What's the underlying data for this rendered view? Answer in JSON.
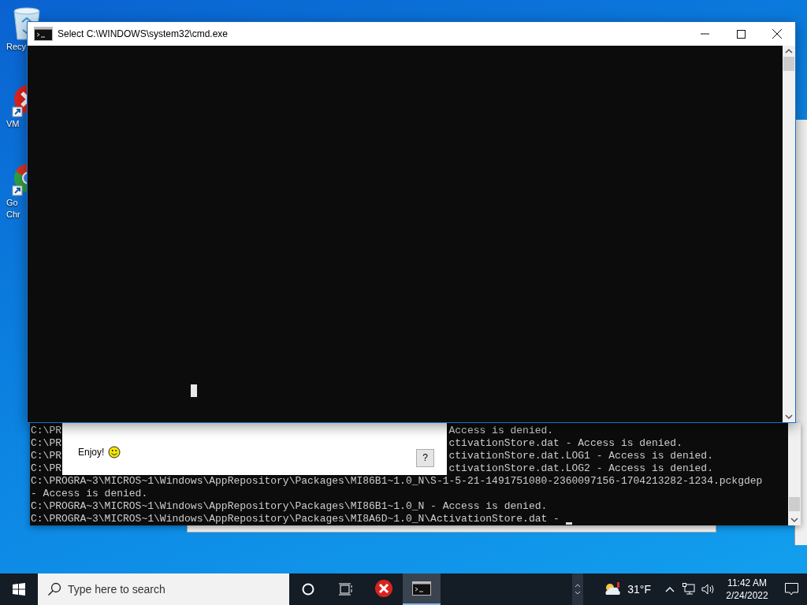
{
  "desktop_icons": [
    {
      "kind": "bin",
      "label_lines": [
        "Recy"
      ]
    },
    {
      "kind": "error",
      "label_lines": [
        "VM"
      ]
    },
    {
      "kind": "round",
      "label_lines": [
        "Go",
        "Chr"
      ]
    }
  ],
  "background_console": {
    "lines": [
      {
        "kind": "split",
        "left": "C:\\PR",
        "right": "Access is denied."
      },
      {
        "kind": "split",
        "left": "C:\\PR",
        "right": "ctivationStore.dat - Access is denied."
      },
      {
        "kind": "split",
        "left": "C:\\PR",
        "right": "ctivationStore.dat.LOG1 - Access is denied."
      },
      {
        "kind": "split",
        "left": "C:\\PR",
        "right": "ctivationStore.dat.LOG2 - Access is denied."
      },
      {
        "kind": "full",
        "text": "C:\\PROGRA~3\\MICROS~1\\Windows\\AppRepository\\Packages\\MI86B1~1.0_N\\S-1-5-21-1491751080-2360097156-1704213282-1234.pckgdep"
      },
      {
        "kind": "full",
        "text": "- Access is denied."
      },
      {
        "kind": "full",
        "text": "C:\\PROGRA~3\\MICROS~1\\Windows\\AppRepository\\Packages\\MI86B1~1.0_N - Access is denied."
      },
      {
        "kind": "full",
        "text": "C:\\PROGRA~3\\MICROS~1\\Windows\\AppRepository\\Packages\\MI8A6D~1.0_N\\ActivationStore.dat -"
      }
    ]
  },
  "message_dialog": {
    "text": "Enjoy!",
    "help_button": "?"
  },
  "cmd_window": {
    "title": "Select C:\\WINDOWS\\system32\\cmd.exe"
  },
  "taskbar": {
    "search_placeholder": "Type here to search",
    "apps": [
      {
        "kind": "error",
        "selected": false
      },
      {
        "kind": "console",
        "selected": true
      }
    ],
    "weather": "31°F",
    "time": "11:42 AM",
    "date": "2/24/2022"
  }
}
